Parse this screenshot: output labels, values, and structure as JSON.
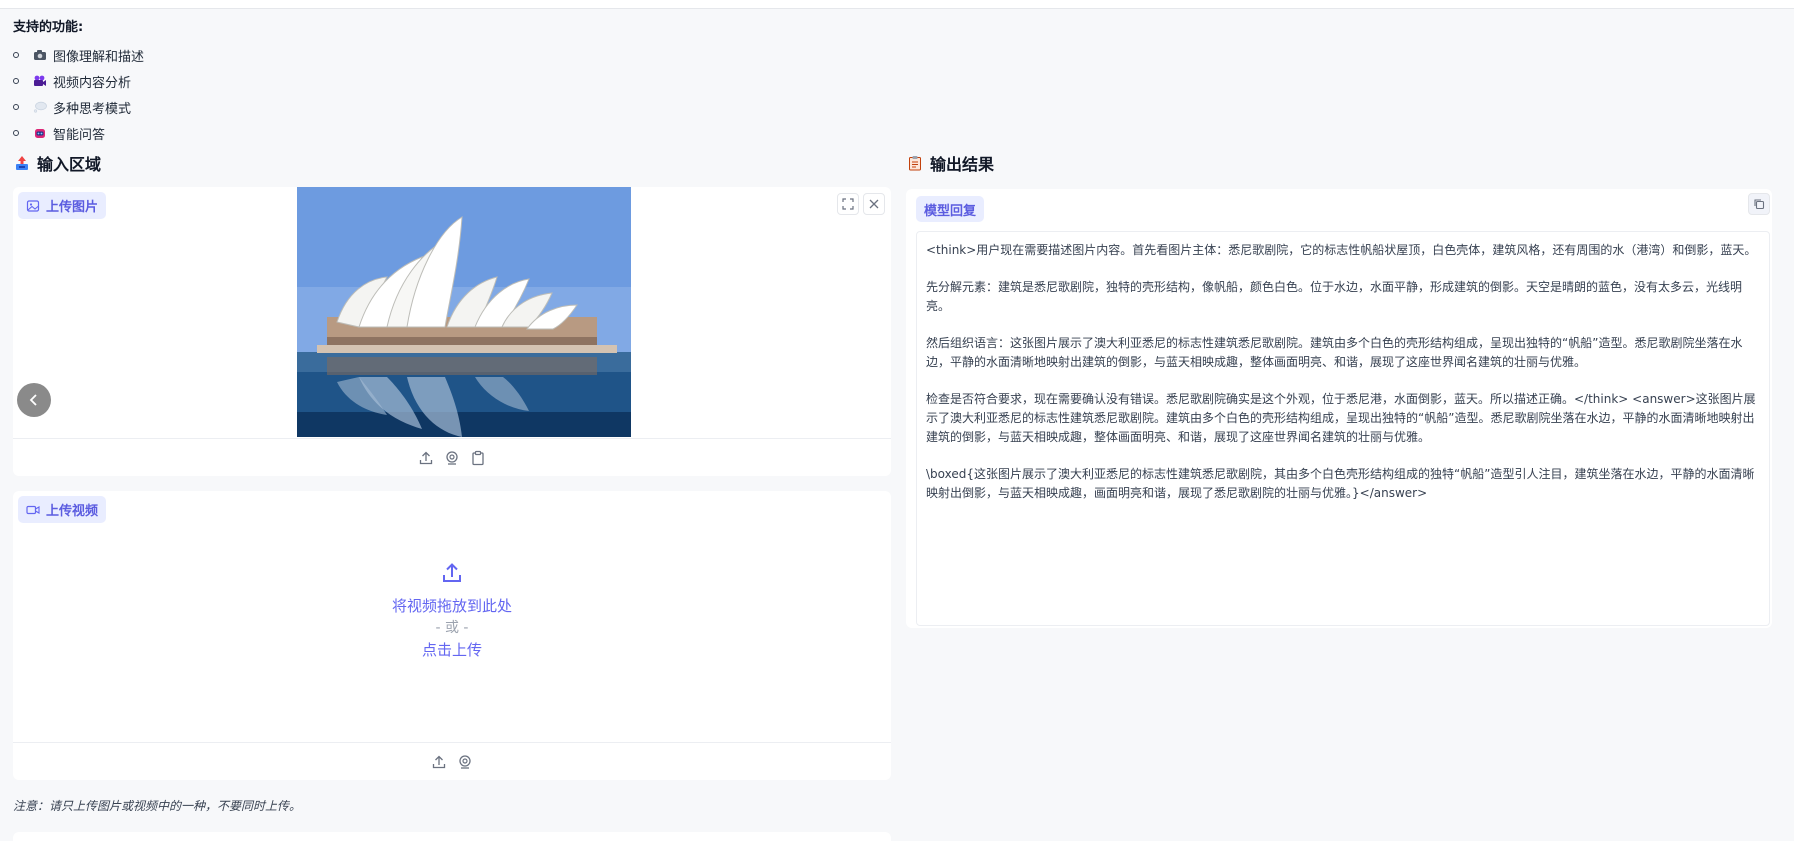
{
  "features": {
    "title": "支持的功能:",
    "items": [
      {
        "icon": "camera-icon",
        "label": "图像理解和描述",
        "color": "#4b5563"
      },
      {
        "icon": "video-camera-icon",
        "label": "视频内容分析",
        "color": "#7c3aed"
      },
      {
        "icon": "thought-bubble-icon",
        "label": "多种思考模式",
        "color": "#cbd5e1"
      },
      {
        "icon": "robot-icon",
        "label": "智能问答",
        "color": "#db2777"
      }
    ]
  },
  "input_section": {
    "title": "输入区域",
    "icon": "inbox-tray-icon",
    "image_panel": {
      "label": "上传图片",
      "tools": [
        "fullscreen-icon",
        "close-icon"
      ],
      "footer_icons": [
        "upload-icon",
        "webcam-icon",
        "clipboard-icon"
      ]
    },
    "video_panel": {
      "label": "上传视频",
      "drop_text": "将视频拖放到此处",
      "or_text": "- 或 -",
      "click_text": "点击上传",
      "footer_icons": [
        "upload-icon",
        "webcam-icon"
      ]
    },
    "note": "注意：请只上传图片或视频中的一种，不要同时上传。"
  },
  "output_section": {
    "title": "输出结果",
    "icon": "clipboard-icon",
    "label": "模型回复",
    "paragraphs": [
      "<think>用户现在需要描述图片内容。首先看图片主体：悉尼歌剧院，它的标志性帆船状屋顶，白色壳体，建筑风格，还有周围的水（港湾）和倒影，蓝天。",
      "先分解元素：建筑是悉尼歌剧院，独特的壳形结构，像帆船，颜色白色。位于水边，水面平静，形成建筑的倒影。天空是晴朗的蓝色，没有太多云，光线明亮。",
      "然后组织语言：这张图片展示了澳大利亚悉尼的标志性建筑悉尼歌剧院。建筑由多个白色的壳形结构组成，呈现出独特的“帆船”造型。悉尼歌剧院坐落在水边，平静的水面清晰地映射出建筑的倒影，与蓝天相映成趣，整体画面明亮、和谐，展现了这座世界闻名建筑的壮丽与优雅。",
      "检查是否符合要求，现在需要确认没有错误。悉尼歌剧院确实是这个外观，位于悉尼港，水面倒影，蓝天。所以描述正确。</think> <answer>这张图片展示了澳大利亚悉尼的标志性建筑悉尼歌剧院。建筑由多个白色的壳形结构组成，呈现出独特的“帆船”造型。悉尼歌剧院坐落在水边，平静的水面清晰地映射出建筑的倒影，与蓝天相映成趣，整体画面明亮、和谐，展现了这座世界闻名建筑的壮丽与优雅。",
      "\\boxed{这张图片展示了澳大利亚悉尼的标志性建筑悉尼歌剧院，其由多个白色壳形结构组成的独特“帆船”造型引人注目，建筑坐落在水边，平静的水面清晰映射出倒影，与蓝天相映成趣，画面明亮和谐，展现了悉尼歌剧院的壮丽与优雅。}</answer>"
    ]
  },
  "colors": {
    "accent": "#6366f1",
    "chip_bg": "#e9edff",
    "page_bg": "#f7f8fa"
  }
}
